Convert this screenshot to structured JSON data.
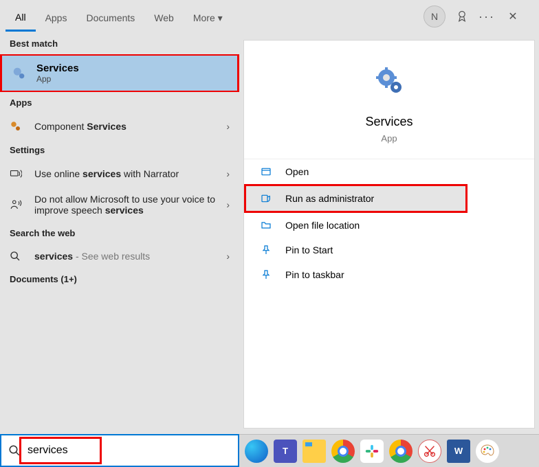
{
  "tabs": {
    "all": "All",
    "apps": "Apps",
    "documents": "Documents",
    "web": "Web",
    "more": "More"
  },
  "header": {
    "avatar_initial": "N"
  },
  "left": {
    "best_match_label": "Best match",
    "best_match": {
      "title": "Services",
      "sub": "App"
    },
    "apps_label": "Apps",
    "apps_item_prefix": "Component ",
    "apps_item_bold": "Services",
    "settings_label": "Settings",
    "setting1_pre": "Use online ",
    "setting1_bold": "services",
    "setting1_post": " with Narrator",
    "setting2_pre": "Do not allow Microsoft to use your voice to improve speech ",
    "setting2_bold": "services",
    "web_label": "Search the web",
    "web_item_bold": "services",
    "web_item_post": " - See web results",
    "docs_label": "Documents (1+)"
  },
  "right": {
    "title": "Services",
    "sub": "App",
    "actions": {
      "open": "Open",
      "admin": "Run as administrator",
      "location": "Open file location",
      "pin_start": "Pin to Start",
      "pin_task": "Pin to taskbar"
    }
  },
  "search": {
    "value": "services"
  }
}
